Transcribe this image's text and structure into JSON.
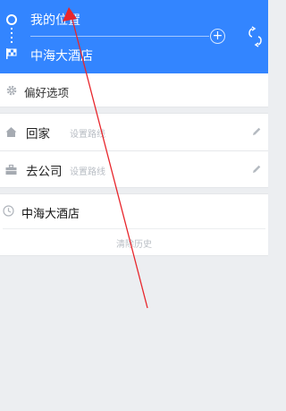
{
  "route": {
    "origin": "我的位置",
    "destination": "中海大酒店",
    "add_label": "+"
  },
  "preferences": {
    "label": "偏好选项"
  },
  "routes": [
    {
      "name": "回家",
      "hint": "设置路线"
    },
    {
      "name": "去公司",
      "hint": "设置路线"
    }
  ],
  "history": {
    "items": [
      "中海大酒店"
    ],
    "clear_label": "清除历史"
  },
  "colors": {
    "header": "#3385ff",
    "annotation": "#e8262c"
  },
  "icons": [
    "origin-dot-icon",
    "destination-flag-icon",
    "add-waypoint-icon",
    "swap-icon",
    "gear-icon",
    "home-icon",
    "briefcase-icon",
    "pencil-icon",
    "clock-icon"
  ]
}
